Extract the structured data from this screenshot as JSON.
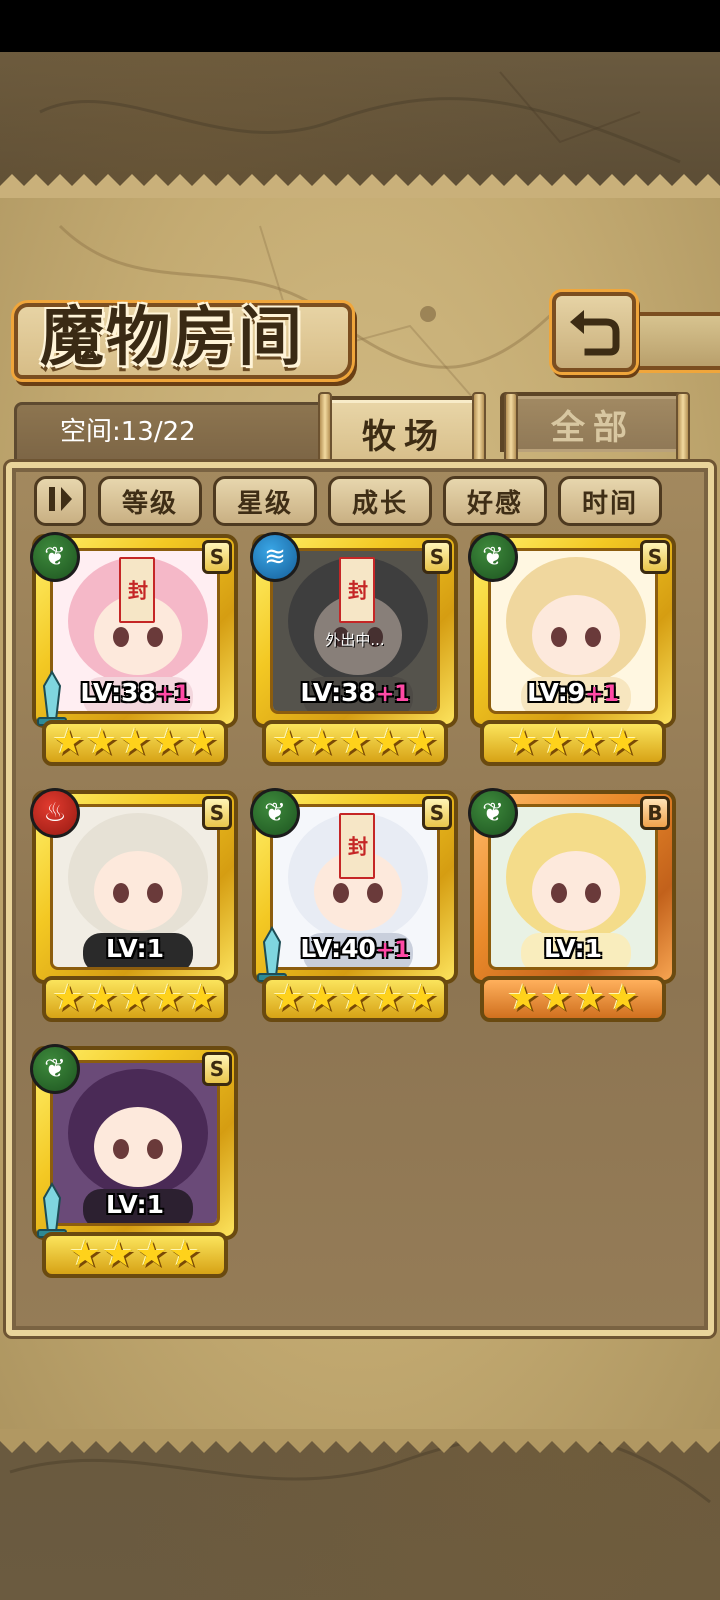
{
  "colors": {
    "scroll": "#c4ab72",
    "panel": "#8d7552",
    "gold_frame": "#f3c823",
    "bronze_frame": "#ea8a2a",
    "element_nature": "#2e6e2e",
    "element_water": "#1f7fc0",
    "element_fire": "#c4261d",
    "level_plus": "#ff4aa6"
  },
  "header": {
    "title": "魔物房间",
    "back_icon": "return-arrow-icon"
  },
  "storage": {
    "space_label": "空间:13/22"
  },
  "tabs": [
    {
      "label": "牧场",
      "active": true
    },
    {
      "label": "全部",
      "active": false
    }
  ],
  "sort": {
    "toggle_icon": "sort-order-icon",
    "buttons": [
      "等级",
      "星级",
      "成长",
      "好感",
      "时间"
    ]
  },
  "monsters": [
    {
      "element": "nature",
      "rank": "S",
      "level": "LV:38",
      "plus": "+1",
      "stars": 5,
      "frame": "gold",
      "weapon": "sword",
      "seal": "封",
      "away": ""
    },
    {
      "element": "water",
      "rank": "S",
      "level": "LV:38",
      "plus": "+1",
      "stars": 5,
      "frame": "gold",
      "weapon": "",
      "seal": "封",
      "away": "外出中..."
    },
    {
      "element": "nature",
      "rank": "S",
      "level": "LV:9",
      "plus": "+1",
      "stars": 4,
      "frame": "gold",
      "weapon": "",
      "seal": "",
      "away": ""
    },
    {
      "element": "fire",
      "rank": "S",
      "level": "LV:1",
      "plus": "",
      "stars": 5,
      "frame": "gold",
      "weapon": "",
      "seal": "",
      "away": ""
    },
    {
      "element": "nature",
      "rank": "S",
      "level": "LV:40",
      "plus": "+1",
      "stars": 5,
      "frame": "gold",
      "weapon": "sword",
      "seal": "封",
      "away": ""
    },
    {
      "element": "nature",
      "rank": "B",
      "level": "LV:1",
      "plus": "",
      "stars": 4,
      "frame": "bronze",
      "weapon": "",
      "seal": "",
      "away": ""
    },
    {
      "element": "nature",
      "rank": "S",
      "level": "LV:1",
      "plus": "",
      "stars": 4,
      "frame": "gold",
      "weapon": "sword",
      "seal": "",
      "away": ""
    }
  ]
}
